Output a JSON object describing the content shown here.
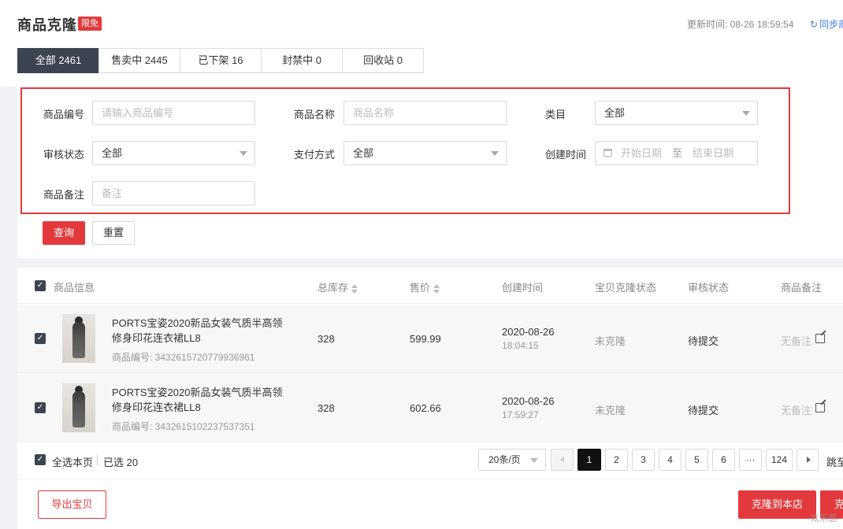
{
  "header": {
    "title": "商品克隆",
    "badge": "限免",
    "update_time": "更新时间: 08-26 18:59:54",
    "sync_label": "同步商"
  },
  "tabs": [
    {
      "label": "全部 2461",
      "active": true
    },
    {
      "label": "售卖中 2445",
      "active": false
    },
    {
      "label": "已下架 16",
      "active": false
    },
    {
      "label": "封禁中 0",
      "active": false
    },
    {
      "label": "回收站 0",
      "active": false
    }
  ],
  "filters": {
    "product_id": {
      "label": "商品编号",
      "placeholder": "请输入商品编号"
    },
    "product_name": {
      "label": "商品名称",
      "placeholder": "商品名称"
    },
    "category": {
      "label": "类目",
      "value": "全部"
    },
    "review_status": {
      "label": "审核状态",
      "value": "全部"
    },
    "payment": {
      "label": "支付方式",
      "value": "全部"
    },
    "created": {
      "label": "创建时间",
      "start_placeholder": "开始日期",
      "separator": "至",
      "end_placeholder": "结束日期"
    },
    "remark": {
      "label": "商品备注",
      "placeholder": "备注"
    },
    "query_button": "查询",
    "reset_button": "重置"
  },
  "table": {
    "columns": [
      "商品信息",
      "总库存",
      "售价",
      "创建时间",
      "宝贝克隆状态",
      "审核状态",
      "商品备注"
    ],
    "rows": [
      {
        "name_line1": "PORTS宝姿2020新品女装气质半高领",
        "name_line2": "修身印花连衣裙LL8",
        "product_id": "商品编号: 3432615720779936961",
        "stock": "328",
        "price": "599.99",
        "date": "2020-08-26",
        "time": "18:04:15",
        "clone_status": "未克隆",
        "review_status": "待提交",
        "remark": "无备注"
      },
      {
        "name_line1": "PORTS宝姿2020新品女装气质半高领",
        "name_line2": "修身印花连衣裙LL8",
        "product_id": "商品编号: 3432615102237537351",
        "stock": "328",
        "price": "602.66",
        "date": "2020-08-26",
        "time": "17:59:27",
        "clone_status": "未克隆",
        "review_status": "待提交",
        "remark": "无备注"
      }
    ]
  },
  "footer": {
    "select_all": "全选本页",
    "selected": "已选 20",
    "page_size": "20条/页",
    "pages": [
      "1",
      "2",
      "3",
      "4",
      "5",
      "6",
      "···",
      "124"
    ],
    "current_page": "1",
    "jump_label": "跳至",
    "export_button": "导出宝贝",
    "clone_button": "克隆到本店",
    "clone_button2": "克"
  },
  "watermark": "欢乐逛",
  "colors": {
    "accent": "#e4393c",
    "dark": "#3d4451",
    "link": "#3a7be0"
  }
}
